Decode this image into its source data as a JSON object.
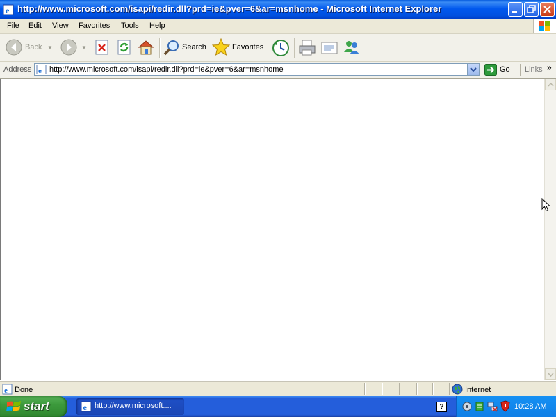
{
  "window": {
    "title": "http://www.microsoft.com/isapi/redir.dll?prd=ie&pver=6&ar=msnhome - Microsoft Internet Explorer"
  },
  "menu": {
    "items": [
      "File",
      "Edit",
      "View",
      "Favorites",
      "Tools",
      "Help"
    ]
  },
  "toolbar": {
    "back_label": "Back",
    "search_label": "Search",
    "favorites_label": "Favorites"
  },
  "address": {
    "label": "Address",
    "value": "http://www.microsoft.com/isapi/redir.dll?prd=ie&pver=6&ar=msnhome",
    "go_label": "Go",
    "links_label": "Links"
  },
  "status": {
    "text": "Done",
    "zone": "Internet"
  },
  "taskbar": {
    "start_label": "start",
    "task_label": "http://www.microsoft....",
    "clock": "10:28 AM"
  },
  "icons": [
    "ie-icon",
    "back-icon",
    "forward-icon",
    "stop-icon",
    "refresh-icon",
    "home-icon",
    "search-icon",
    "favorites-star-icon",
    "history-icon",
    "print-icon",
    "edit-icon",
    "messenger-icon",
    "go-arrow-icon",
    "globe-icon",
    "windows-logo-icon"
  ],
  "colors": {
    "titlebar": "#0058ee",
    "chrome": "#ece9d8",
    "start_button": "#3c9a3c",
    "taskbar": "#245edb",
    "tray": "#0f7fe6"
  }
}
